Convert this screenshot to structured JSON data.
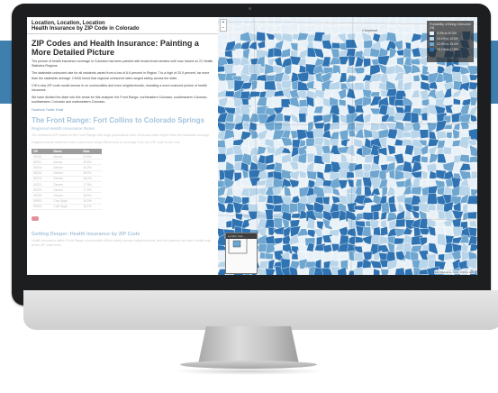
{
  "article": {
    "kicker": "Location, Location, Location",
    "subtitle": "Health Insurance by ZIP Code in Colorado",
    "title": "ZIP Codes and Health Insurance: Painting a More Detailed Picture",
    "para1": "The picture of health insurance coverage in Colorado has been painted with broad brush strokes until now, based on 21 Health Statistics Regions.",
    "para2": "The statewide uninsured rate for all residents varied from a low of 6.6 percent in Region 7 to a high of 20.9 percent, far more than the statewide average. CHAS found that regional uninsured rates ranged widely across the state.",
    "para3": "CHI's new ZIP code model zeroes in on communities and even neighborhoods, revealing a more nuanced picture of health insurance.",
    "para4": "We have divided the state into five areas for this analysis: the Front Range, northeastern Colorado, southeastern Colorado, southwestern Colorado and northwestern Colorado.",
    "links": "Facebook   Twitter   Email",
    "section_title": "The Front Range: Fort Collins to Colorado Springs",
    "section_sub": "Regional Health Insurance Rates",
    "section_body": "Ten uninsured ZIP codes on the Front Range with large populations have uninsured rates higher than the statewide average.",
    "section_body2": "Neighborhoods within the metro area show sharp differences in coverage from one ZIP code to the next.",
    "table_headers": [
      "ZIP",
      "Name",
      "Rate"
    ],
    "table_rows": [
      [
        "80010",
        "Aurora",
        "24.6%"
      ],
      [
        "80011",
        "Aurora",
        "19.8%"
      ],
      [
        "80204",
        "Denver",
        "19.2%"
      ],
      [
        "80216",
        "Denver",
        "18.9%"
      ],
      [
        "80219",
        "Denver",
        "18.4%"
      ],
      [
        "80221",
        "Denver",
        "17.9%"
      ],
      [
        "80229",
        "Denver",
        "17.0%"
      ],
      [
        "80239",
        "Denver",
        "16.8%"
      ],
      [
        "80903",
        "Colo Spgs",
        "16.5%"
      ],
      [
        "80910",
        "Colo Spgs",
        "16.1%"
      ]
    ],
    "section2_title": "Getting Deeper: Health Insurance by ZIP Code",
    "section2_body": "Health insurance within Front Range communities differs widely across neighborhoods, and the patterns are often visible only at the ZIP code level."
  },
  "map": {
    "zoom_in": "+",
    "zoom_out": "−",
    "cities": [
      "Cheyenne",
      "Fort Collins",
      "Greeley",
      "Boulder",
      "Denver",
      "Aurora"
    ],
    "legend_title": "Probability of Being Uninsured (%)",
    "legend": [
      {
        "label": "0.0% to 10.0%",
        "color": "#e8f1f8"
      },
      {
        "label": "10.1% to 12.5%",
        "color": "#b9d5ea"
      },
      {
        "label": "12.6% to 15.0%",
        "color": "#6ea6d0"
      },
      {
        "label": "15.1% to 17.5%",
        "color": "#2f73b2"
      }
    ],
    "mini_title": "Locator map",
    "attribution": "Esri, DeLorme, FAO, USGS, EPA"
  }
}
